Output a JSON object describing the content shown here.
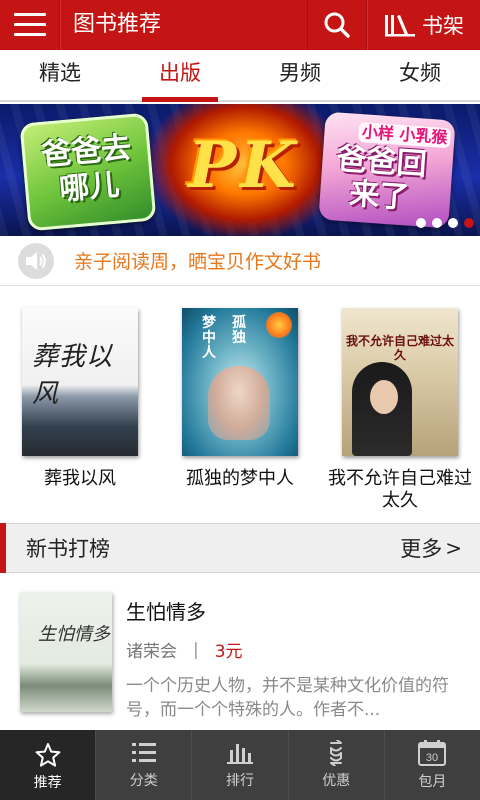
{
  "header": {
    "menu_icon": "hamburger-menu-icon",
    "title": "图书推荐",
    "search_icon": "search-icon",
    "shelf_icon": "bookshelf-icon",
    "shelf_label": "书架",
    "bg_color": "#c51414"
  },
  "tabs": [
    {
      "label": "精选",
      "active": false
    },
    {
      "label": "出版",
      "active": true
    },
    {
      "label": "男频",
      "active": false
    },
    {
      "label": "女频",
      "active": false
    }
  ],
  "banner": {
    "left_text": "爸爸去哪儿",
    "center_text": "PK",
    "right_text": "爸爸回来了",
    "right_tag": "小样 小乳猴",
    "dots_count": 4,
    "active_dot_index": 3
  },
  "notice": {
    "icon": "speaker-icon",
    "text": "亲子阅读周，晒宝贝作文好书"
  },
  "books": [
    {
      "title": "葬我以风",
      "cover_text": "葬我以风"
    },
    {
      "title": "孤独的梦中人",
      "cover_text_a": "孤独",
      "cover_text_b": "梦中人"
    },
    {
      "title": "我不允许自己难过太久",
      "cover_text": "我不允许自己难过太久"
    }
  ],
  "section": {
    "title": "新书打榜",
    "more_label": "更多",
    "more_icon": "chevron-right-icon",
    "accent": "#c51414"
  },
  "list_item": {
    "title": "生怕情多",
    "author": "诸荣会",
    "separator": "|",
    "price": "3元",
    "description": "一个个历史人物，并不是某种文化价值的符号，而一个个特殊的人。作者不...",
    "cover_text": "生怕情多"
  },
  "bottom_nav": [
    {
      "label": "推荐",
      "icon": "star-icon",
      "active": true
    },
    {
      "label": "分类",
      "icon": "list-icon",
      "active": false
    },
    {
      "label": "排行",
      "icon": "bar-chart-icon",
      "active": false
    },
    {
      "label": "优惠",
      "icon": "discount-icon",
      "active": false
    },
    {
      "label": "包月",
      "icon": "calendar-icon",
      "active": false,
      "badge": "30"
    }
  ]
}
